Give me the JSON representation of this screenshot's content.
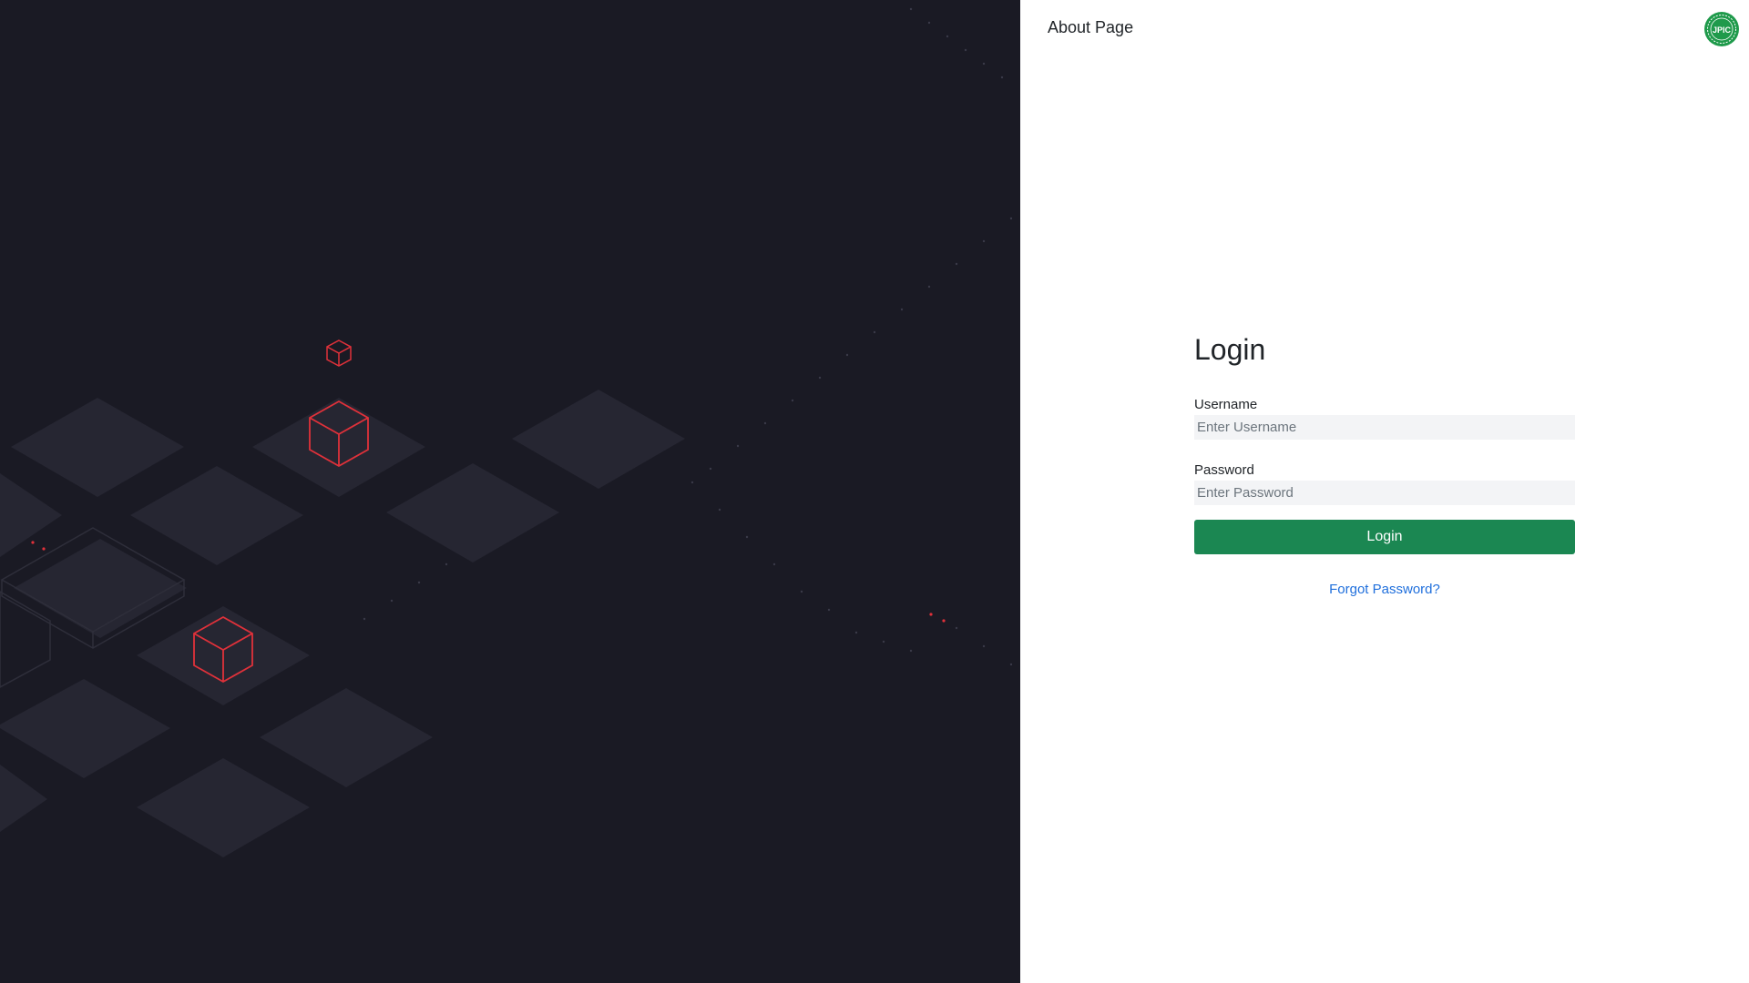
{
  "header": {
    "about_link": "About Page",
    "logo_icon": "company-seal-logo-icon",
    "logo_text": "JPIC"
  },
  "login": {
    "title": "Login",
    "username_label": "Username",
    "username_placeholder": "Enter Username",
    "username_value": "",
    "password_label": "Password",
    "password_placeholder": "Enter Password",
    "password_value": "",
    "submit_label": "Login",
    "forgot_link": "Forgot Password?"
  },
  "colors": {
    "art_background": "#1a1a24",
    "tile": "#262632",
    "cube_stroke": "#e0313a",
    "button": "#1b8752",
    "link": "#1f6fdc",
    "logo": "#1f9a4b"
  }
}
